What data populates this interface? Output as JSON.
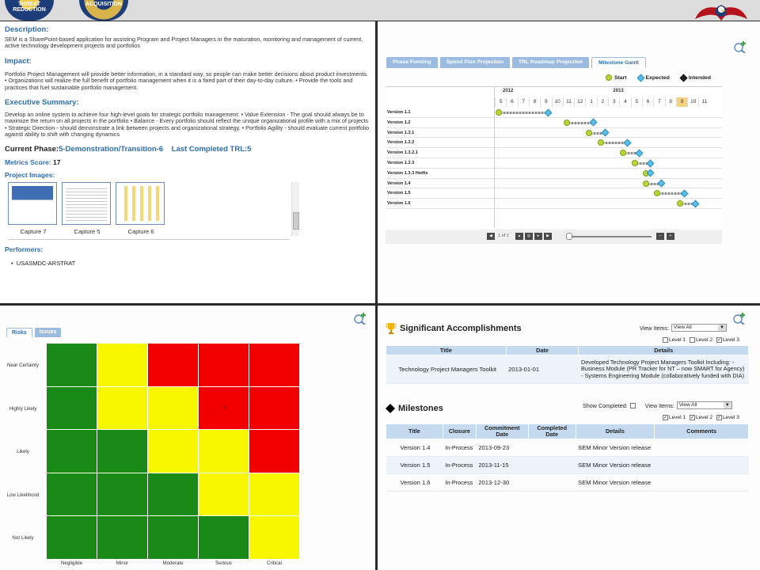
{
  "header": {
    "seal1_text": "THREAT REDUCTION",
    "seal2_text": "ACQUISITION"
  },
  "overview": {
    "description_label": "Description:",
    "description": "SEM is a SharePoint-based application for assisting Program and Project Managers in the maturation, monitoring and management of current, active technology development projects and portfolios",
    "impact_label": "Impact:",
    "impact": "Portfolio Project Management will provide better information, in a standard way, so people can make better decisions about product investments. • Organizations will realize the full benefit of portfolio management when it is a fixed part of their day-to-day culture. • Provide the tools and practices that fuel sustainable portfolio management.",
    "exec_label": "Executive Summary:",
    "exec": "Develop an online system to achieve four high-level goals for strategic portfolio management: • Value Extension - The goal should always be to maximize the return on all projects in the portfolio • Balance - Every portfolio should reflect the unique organizational profile with a mix of projects • Strategic Direction - should demonstrate a link between projects and organizational strategy. • Portfolio Agility - should evaluate current portfolio against ability to shift with changing dynamics",
    "phase_label": "Current Phase:",
    "phase_value": "5-Demonstration/Transition-6",
    "trl_label": "Last Completed TRL:",
    "trl_value": "5",
    "metrics_label": "Metrics Score:",
    "metrics_value": "17",
    "images_label": "Project Images:",
    "images": [
      "Capture 7",
      "Capture 5",
      "Capture 6"
    ],
    "performers_label": "Performers:",
    "performer": "USASMDC-ARSTRAT"
  },
  "gantt": {
    "tabs": [
      "Phase Funding",
      "Spend Plan Projection",
      "TRL Roadmap Projection",
      "Milestone Gantt"
    ],
    "active_tab": 3,
    "legend": {
      "start": "Start",
      "expected": "Expected",
      "intended": "Intended"
    },
    "years": [
      "2012",
      "2013"
    ],
    "months": [
      "5",
      "6",
      "7",
      "8",
      "9",
      "10",
      "11",
      "12",
      "1",
      "2",
      "3",
      "4",
      "5",
      "6",
      "7",
      "8",
      "9",
      "10",
      "11"
    ],
    "current_month_index": 16,
    "rows": [
      {
        "label": "Version 1.1",
        "start": 0,
        "end": 4
      },
      {
        "label": "Version 1.2",
        "start": 6,
        "end": 8
      },
      {
        "label": "Version 1.3.1",
        "start": 8,
        "end": 9
      },
      {
        "label": "Version 1.3.2",
        "start": 9,
        "end": 11
      },
      {
        "label": "Version 1.3.2.1",
        "start": 11,
        "end": 12
      },
      {
        "label": "Version 1.3.3",
        "start": 12,
        "end": 13
      },
      {
        "label": "Version 1.3.3 Hotfix",
        "start": 13,
        "end": 13
      },
      {
        "label": "Version 1.4",
        "start": 13,
        "end": 14
      },
      {
        "label": "Version 1.5",
        "start": 14,
        "end": 16
      },
      {
        "label": "Version 1.6",
        "start": 16,
        "end": 17
      }
    ],
    "pager_text": "1 of 1"
  },
  "risk": {
    "tabs": [
      "Risks",
      "Issues"
    ],
    "likelihood": [
      "Near Certainty",
      "Highly Likely",
      "Likely",
      "Low Likelihood",
      "Not Likely"
    ],
    "consequence": [
      "Negligible",
      "Minor",
      "Moderate",
      "Serious",
      "Critical"
    ],
    "matrix": [
      [
        "g",
        "y",
        "r",
        "r",
        "r"
      ],
      [
        "g",
        "y",
        "y",
        "r",
        "r"
      ],
      [
        "g",
        "g",
        "y",
        "y",
        "r"
      ],
      [
        "g",
        "g",
        "g",
        "y",
        "y"
      ],
      [
        "g",
        "g",
        "g",
        "g",
        "y"
      ]
    ],
    "colors": {
      "g": "#1a8a17",
      "y": "#f7f700",
      "r": "#f20000"
    },
    "count_cell": {
      "row": 1,
      "col": 3,
      "value": "6"
    }
  },
  "accomplishments": {
    "title": "Significant Accomplishments",
    "view_items_label": "View Items:",
    "view_items_value": "View All",
    "levels": [
      "Level 1",
      "Level 2",
      "Level 3"
    ],
    "levels_checked": [
      false,
      false,
      true
    ],
    "columns": [
      "Title",
      "Date",
      "Details"
    ],
    "rows": [
      {
        "title": "Technology Project Managers Toolkit",
        "date": "2013-01-01",
        "details": "Developed Technology Project Managers Toolkit Including: - Business Module (PR Tracker for NT – now SMART for Agency) - Systems Engineering Module (collaboratively funded with DIA)"
      }
    ]
  },
  "milestones": {
    "title": "Milestones",
    "show_completed_label": "Show Completed:",
    "view_items_label": "View Items:",
    "view_items_value": "View All",
    "levels": [
      "Level 1",
      "Level 2",
      "Level 3"
    ],
    "levels_checked": [
      true,
      true,
      true
    ],
    "columns": [
      "Title",
      "Closure",
      "Commitment Date",
      "Completed Date",
      "Details",
      "Comments"
    ],
    "rows": [
      {
        "title": "Version 1.4",
        "closure": "In-Process",
        "commit": "2013-09-23",
        "completed": "",
        "details": "SEM Minor Version release",
        "comments": ""
      },
      {
        "title": "Version 1.5",
        "closure": "In-Process",
        "commit": "2013-11-15",
        "completed": "",
        "details": "SEM Minor Version release",
        "comments": ""
      },
      {
        "title": "Version 1.6",
        "closure": "In-Process",
        "commit": "2013-12-30",
        "completed": "",
        "details": "SEM Minor Version release",
        "comments": ""
      }
    ]
  }
}
